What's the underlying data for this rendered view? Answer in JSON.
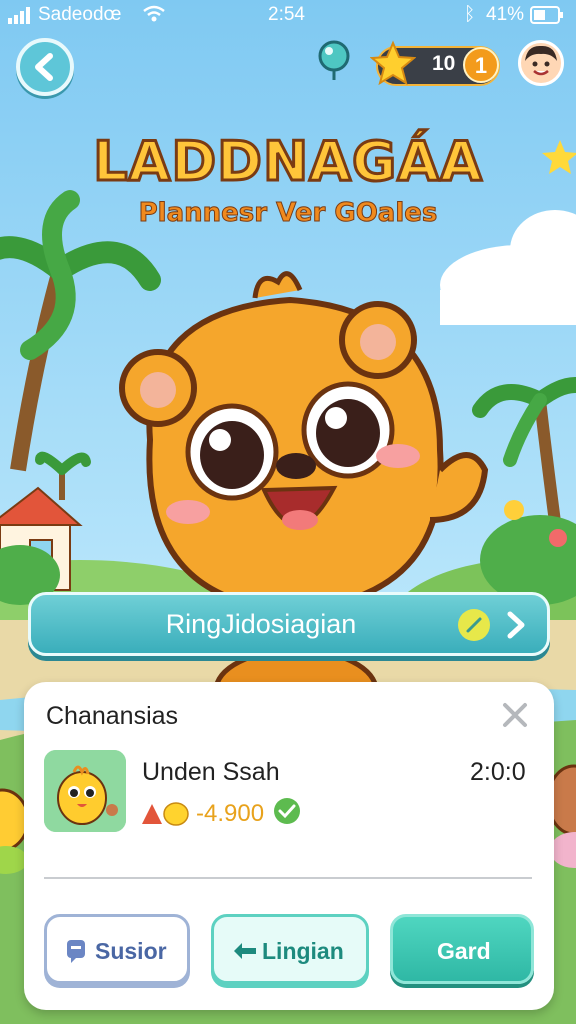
{
  "status_bar": {
    "carrier": "Sadeodœ",
    "time": "2:54",
    "battery": "41%"
  },
  "top_bar": {
    "coins": "10"
  },
  "title": {
    "main": "LADDNAGÁA",
    "subtitle": "Plannesr Ver GOales"
  },
  "main_button": {
    "label": "RingJidosiagian"
  },
  "card": {
    "title": "Chanansias",
    "item": {
      "name": "Unden Ssah",
      "time": "2:0:0",
      "price": "-4.900"
    },
    "buttons": {
      "left": "Susior",
      "middle": "Lingian",
      "right": "Gard"
    }
  },
  "colors": {
    "sky": "#8fd3f5",
    "accent_teal": "#3aaebb",
    "title_fill": "#ffc53a",
    "title_stroke": "#7a3b13",
    "bear": "#f5a62c"
  }
}
